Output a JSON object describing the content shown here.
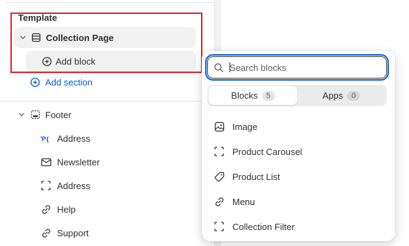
{
  "sidebar": {
    "section_title": "Template",
    "collection": {
      "label": "Collection Page"
    },
    "add_block": {
      "label": "Add block"
    },
    "add_section": {
      "label": "Add section"
    },
    "footer": {
      "label": "Footer",
      "items": [
        {
          "label": "Address",
          "icon": "address-glyph-icon"
        },
        {
          "label": "Newsletter",
          "icon": "mail-icon"
        },
        {
          "label": "Address",
          "icon": "dashed-square-icon"
        },
        {
          "label": "Help",
          "icon": "link-icon"
        },
        {
          "label": "Support",
          "icon": "link-icon"
        }
      ]
    }
  },
  "popover": {
    "search": {
      "placeholder": "Search blocks",
      "value": ""
    },
    "tabs": [
      {
        "label": "Blocks",
        "count": "5",
        "active": true
      },
      {
        "label": "Apps",
        "count": "0",
        "active": false
      }
    ],
    "blocks": [
      {
        "label": "Image",
        "icon": "image-icon"
      },
      {
        "label": "Product Carousel",
        "icon": "dashed-square-icon"
      },
      {
        "label": "Product List",
        "icon": "tag-icon"
      },
      {
        "label": "Menu",
        "icon": "link-icon"
      },
      {
        "label": "Collection Filter",
        "icon": "dashed-square-icon"
      }
    ]
  },
  "colors": {
    "accent_blue": "#005bd3",
    "highlight_red": "#e51c23",
    "text": "#303030"
  }
}
